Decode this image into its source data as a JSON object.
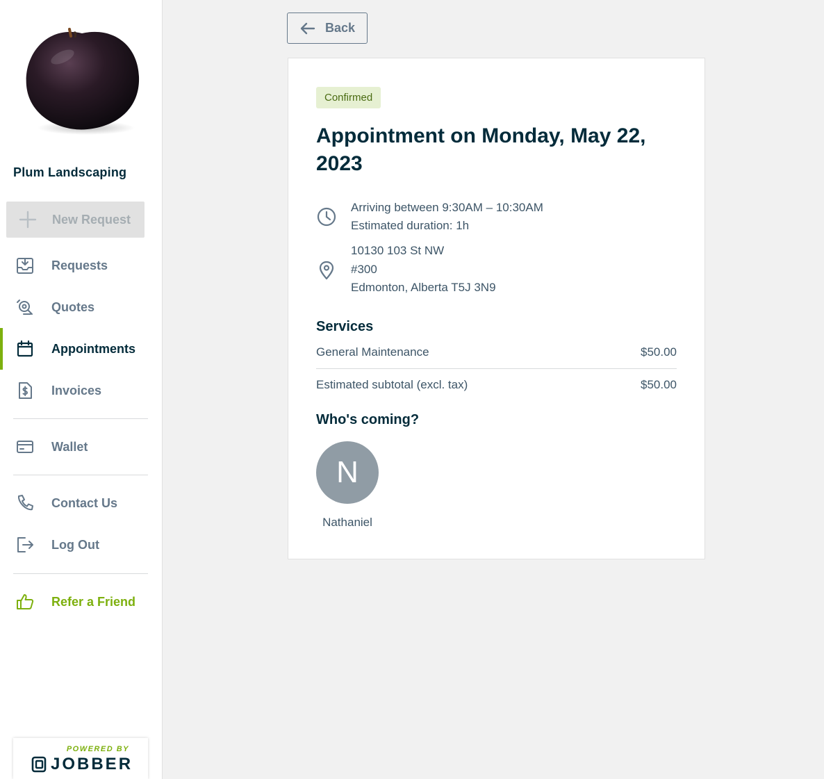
{
  "sidebar": {
    "company_name": "Plum Landscaping",
    "new_request_label": "New Request",
    "items": [
      {
        "label": "Requests",
        "icon": "inbox-download-icon"
      },
      {
        "label": "Quotes",
        "icon": "quote-search-icon"
      },
      {
        "label": "Appointments",
        "icon": "calendar-icon",
        "active": true
      },
      {
        "label": "Invoices",
        "icon": "invoice-dollar-icon"
      },
      {
        "label": "Wallet",
        "icon": "credit-card-icon"
      },
      {
        "label": "Contact Us",
        "icon": "phone-icon"
      },
      {
        "label": "Log Out",
        "icon": "logout-icon"
      },
      {
        "label": "Refer a Friend",
        "icon": "thumbs-up-icon"
      }
    ],
    "powered_by": "POWERED BY",
    "brand": "JOBBER"
  },
  "toolbar": {
    "back_label": "Back"
  },
  "appointment": {
    "status": "Confirmed",
    "title": "Appointment on Monday, May 22, 2023",
    "arrival": "Arriving between 9:30AM – 10:30AM",
    "duration": "Estimated duration: 1h",
    "address": {
      "line1": "10130 103 St NW",
      "line2": "#300",
      "line3": "Edmonton, Alberta T5J 3N9"
    },
    "services_heading": "Services",
    "services": [
      {
        "name": "General Maintenance",
        "price": "$50.00"
      }
    ],
    "subtotal_label": "Estimated subtotal (excl. tax)",
    "subtotal_value": "$50.00",
    "team_heading": "Who's coming?",
    "team": [
      {
        "initial": "N",
        "name": "Nathaniel"
      }
    ]
  },
  "colors": {
    "accent": "#7db00e",
    "navy": "#032b3a",
    "muted": "#65788a",
    "badge_bg": "#e6f0d2",
    "avatar_bg": "#909ca5"
  }
}
